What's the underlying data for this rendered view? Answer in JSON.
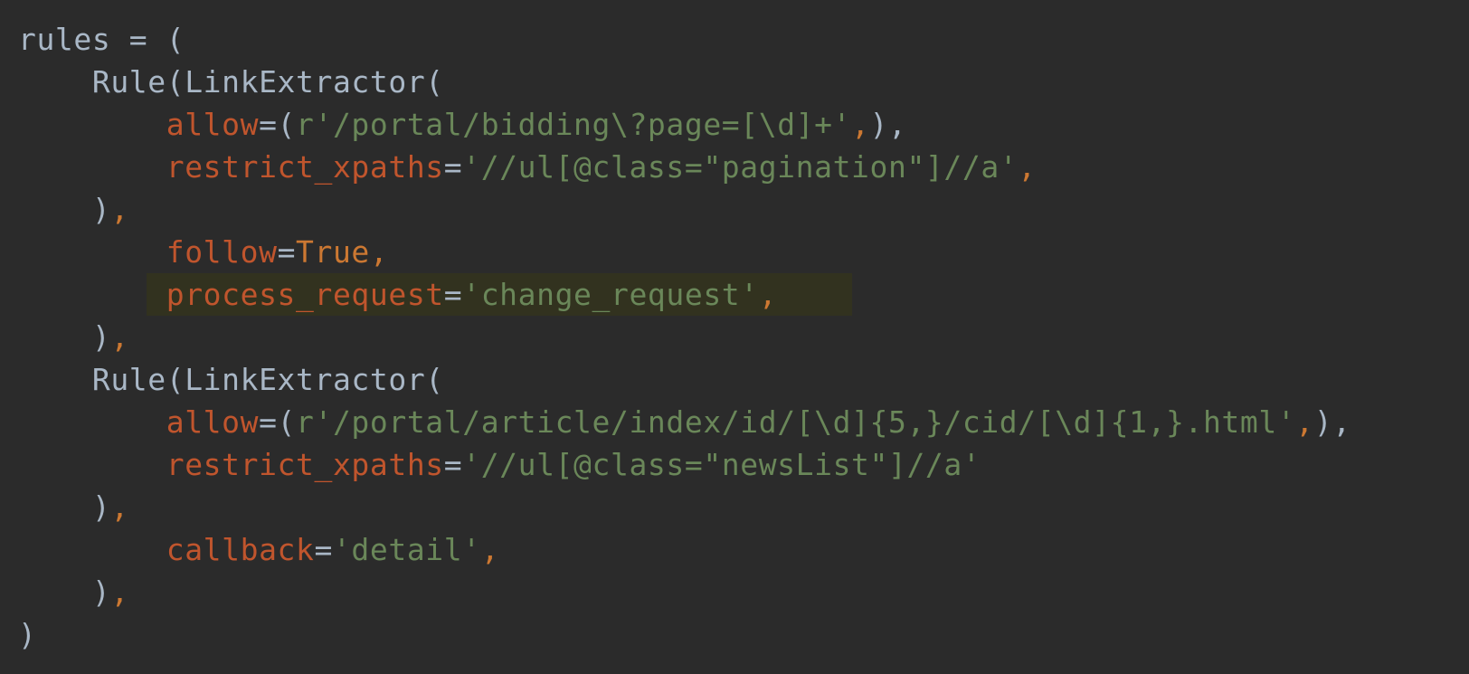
{
  "editor": {
    "background": "#2b2b2b",
    "highlighted_line_background": "#32321f",
    "token_colors": {
      "plain": "#a9b7c6",
      "kwarg": "#c0552d",
      "string": "#6a8759",
      "punctuation": "#cc7832",
      "keyword": "#cc7832"
    },
    "lines": [
      {
        "tokens": [
          {
            "t": "plain",
            "v": "rules = ("
          }
        ]
      },
      {
        "tokens": [
          {
            "t": "plain",
            "v": "    Rule(LinkExtractor("
          }
        ]
      },
      {
        "tokens": [
          {
            "t": "plain",
            "v": "        "
          },
          {
            "t": "kwarg",
            "v": "allow"
          },
          {
            "t": "plain",
            "v": "=("
          },
          {
            "t": "str",
            "v": "r'/portal/bidding\\?page=[\\d]+'"
          },
          {
            "t": "punct",
            "v": ","
          },
          {
            "t": "plain",
            "v": "),"
          }
        ]
      },
      {
        "tokens": [
          {
            "t": "plain",
            "v": "        "
          },
          {
            "t": "kwarg",
            "v": "restrict_xpaths"
          },
          {
            "t": "plain",
            "v": "="
          },
          {
            "t": "str",
            "v": "'//ul[@class=\"pagination\"]//a'"
          },
          {
            "t": "punct",
            "v": ","
          }
        ]
      },
      {
        "tokens": [
          {
            "t": "plain",
            "v": "    )"
          },
          {
            "t": "punct",
            "v": ","
          }
        ]
      },
      {
        "tokens": [
          {
            "t": "plain",
            "v": "        "
          },
          {
            "t": "kwarg",
            "v": "follow"
          },
          {
            "t": "plain",
            "v": "="
          },
          {
            "t": "kw",
            "v": "True"
          },
          {
            "t": "punct",
            "v": ","
          }
        ]
      },
      {
        "highlight": true,
        "tokens": [
          {
            "t": "plain",
            "v": "        "
          },
          {
            "t": "kwarg",
            "v": "process_request"
          },
          {
            "t": "plain",
            "v": "="
          },
          {
            "t": "str",
            "v": "'change_request'"
          },
          {
            "t": "punct",
            "v": ","
          }
        ]
      },
      {
        "tokens": [
          {
            "t": "plain",
            "v": "    )"
          },
          {
            "t": "punct",
            "v": ","
          }
        ]
      },
      {
        "tokens": [
          {
            "t": "plain",
            "v": "    Rule(LinkExtractor("
          }
        ]
      },
      {
        "tokens": [
          {
            "t": "plain",
            "v": "        "
          },
          {
            "t": "kwarg",
            "v": "allow"
          },
          {
            "t": "plain",
            "v": "=("
          },
          {
            "t": "str",
            "v": "r'/portal/article/index/id/[\\d]{5,}/cid/[\\d]{1,}.html'"
          },
          {
            "t": "punct",
            "v": ","
          },
          {
            "t": "plain",
            "v": "),"
          }
        ]
      },
      {
        "tokens": [
          {
            "t": "plain",
            "v": "        "
          },
          {
            "t": "kwarg",
            "v": "restrict_xpaths"
          },
          {
            "t": "plain",
            "v": "="
          },
          {
            "t": "str",
            "v": "'//ul[@class=\"newsList\"]//a'"
          }
        ]
      },
      {
        "tokens": [
          {
            "t": "plain",
            "v": "    )"
          },
          {
            "t": "punct",
            "v": ","
          }
        ]
      },
      {
        "tokens": [
          {
            "t": "plain",
            "v": "        "
          },
          {
            "t": "kwarg",
            "v": "callback"
          },
          {
            "t": "plain",
            "v": "="
          },
          {
            "t": "str",
            "v": "'detail'"
          },
          {
            "t": "punct",
            "v": ","
          }
        ]
      },
      {
        "tokens": [
          {
            "t": "plain",
            "v": "    )"
          },
          {
            "t": "punct",
            "v": ","
          }
        ]
      },
      {
        "tokens": [
          {
            "t": "plain",
            "v": ")"
          }
        ]
      }
    ]
  }
}
